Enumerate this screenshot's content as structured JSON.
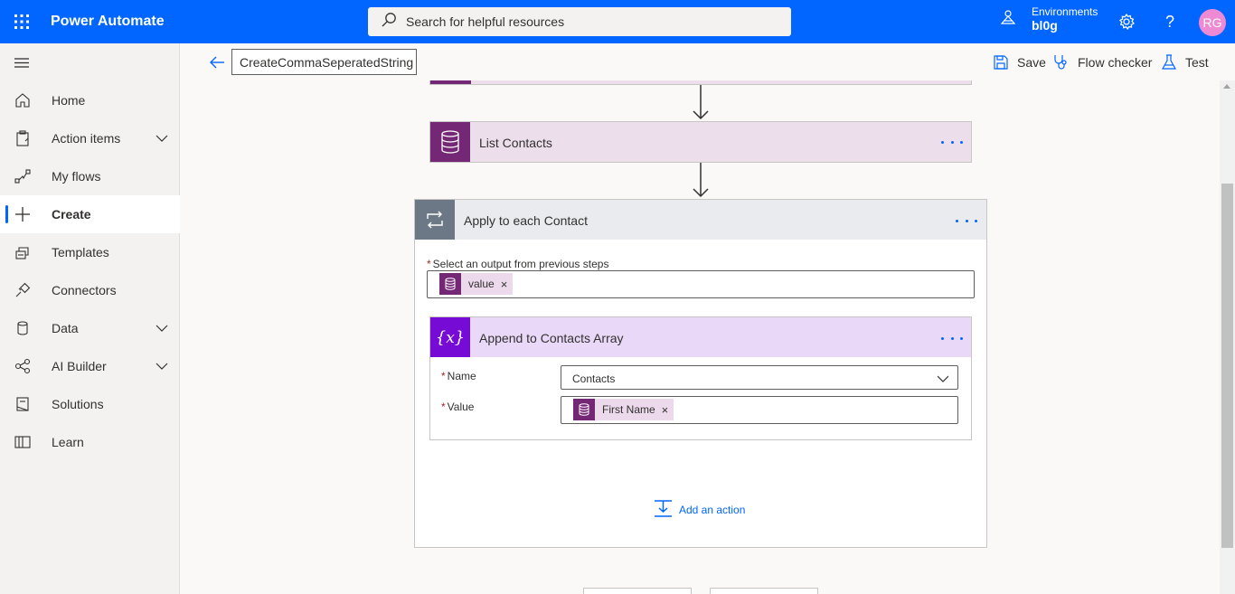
{
  "header": {
    "app_name": "Power Automate",
    "search_placeholder": "Search for helpful resources",
    "environment_label": "Environments",
    "environment_value": "bl0g",
    "avatar_initials": "RG"
  },
  "sidebar": {
    "items": [
      {
        "label": "Home",
        "icon": "home-icon"
      },
      {
        "label": "Action items",
        "icon": "clipboard-icon",
        "expandable": true
      },
      {
        "label": "My flows",
        "icon": "flow-icon"
      },
      {
        "label": "Create",
        "icon": "plus-icon",
        "active": true
      },
      {
        "label": "Templates",
        "icon": "templates-icon"
      },
      {
        "label": "Connectors",
        "icon": "connector-icon"
      },
      {
        "label": "Data",
        "icon": "database-icon",
        "expandable": true
      },
      {
        "label": "AI Builder",
        "icon": "ai-builder-icon",
        "expandable": true
      },
      {
        "label": "Solutions",
        "icon": "solutions-icon"
      },
      {
        "label": "Learn",
        "icon": "book-icon"
      }
    ]
  },
  "commandbar": {
    "flow_name": "CreateCommaSeperatedString",
    "save_label": "Save",
    "flow_checker_label": "Flow checker",
    "test_label": "Test"
  },
  "canvas": {
    "list_contacts": {
      "title": "List Contacts"
    },
    "apply_each": {
      "title": "Apply to each Contact",
      "output_label": "Select an output from previous steps",
      "output_token": "value",
      "add_action_label": "Add an action"
    },
    "append": {
      "title": "Append to Contacts Array",
      "name_label": "Name",
      "name_value": "Contacts",
      "value_label": "Value",
      "value_token": "First Name"
    }
  },
  "colors": {
    "brand": "#0066ff",
    "dataverse": "#742774",
    "variable": "#770bd6",
    "loop": "#6d7886"
  }
}
